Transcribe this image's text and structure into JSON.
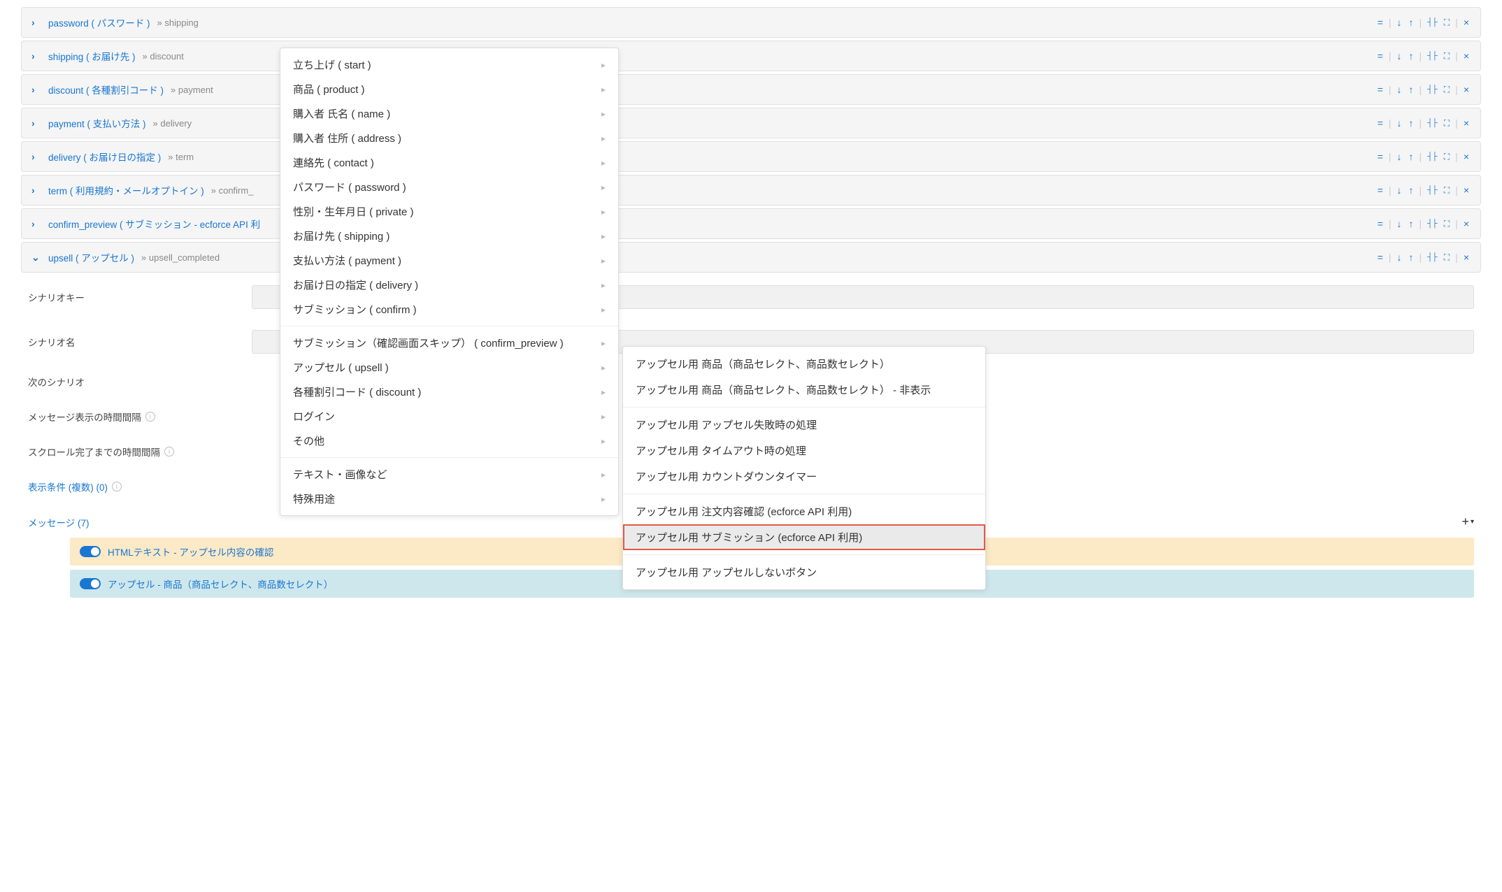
{
  "sections": [
    {
      "name": "password ( パスワード )",
      "next": "» shipping",
      "expanded": false
    },
    {
      "name": "shipping ( お届け先 )",
      "next": "» discount",
      "expanded": false
    },
    {
      "name": "discount ( 各種割引コード )",
      "next": "» payment",
      "expanded": false
    },
    {
      "name": "payment ( 支払い方法 )",
      "next": "» delivery",
      "expanded": false
    },
    {
      "name": "delivery ( お届け日の指定 )",
      "next": "» term",
      "expanded": false
    },
    {
      "name": "term ( 利用規約・メールオプトイン )",
      "next": "» confirm_",
      "expanded": false
    },
    {
      "name": "confirm_preview ( サブミッション - ecforce API 利",
      "next": "",
      "expanded": false
    },
    {
      "name": "upsell ( アップセル )",
      "next": "» upsell_completed",
      "expanded": true
    }
  ],
  "actions": {
    "equals": "=",
    "down": "↓",
    "up": "↑",
    "collapse_h": "┤├",
    "expand": "⛶",
    "close": "×"
  },
  "detail": {
    "labels": {
      "scenario_key": "シナリオキー",
      "scenario_name": "シナリオ名",
      "next_scenario": "次のシナリオ",
      "msg_interval": "メッセージ表示の時間間隔",
      "scroll_interval": "スクロール完了までの時間間隔",
      "display_cond": "表示条件 (複数) (0)",
      "messages": "メッセージ (7)"
    },
    "messages": [
      {
        "text": "HTMLテキスト - アップセル内容の確認",
        "color": "yellow"
      },
      {
        "text": "アップセル - 商品（商品セレクト、商品数セレクト）",
        "color": "blue"
      }
    ]
  },
  "dropdown1_groups": [
    {
      "items": [
        {
          "label": "立ち上げ ( start )"
        },
        {
          "label": "商品 ( product )"
        },
        {
          "label": "購入者 氏名 ( name )"
        },
        {
          "label": "購入者 住所 ( address )"
        },
        {
          "label": "連絡先 ( contact )"
        },
        {
          "label": "パスワード ( password )"
        },
        {
          "label": "性別・生年月日 ( private )"
        },
        {
          "label": "お届け先 ( shipping )"
        },
        {
          "label": "支払い方法 ( payment )"
        },
        {
          "label": "お届け日の指定 ( delivery )"
        },
        {
          "label": "サブミッション ( confirm )"
        }
      ]
    },
    {
      "items": [
        {
          "label": "サブミッション（確認画面スキップ） ( confirm_preview )"
        },
        {
          "label": "アップセル ( upsell )"
        },
        {
          "label": "各種割引コード ( discount )"
        },
        {
          "label": "ログイン"
        },
        {
          "label": "その他"
        }
      ]
    },
    {
      "items": [
        {
          "label": "テキスト・画像など"
        },
        {
          "label": "特殊用途"
        }
      ]
    }
  ],
  "dropdown2_groups": [
    {
      "items": [
        {
          "label": "アップセル用 商品（商品セレクト、商品数セレクト）"
        },
        {
          "label": "アップセル用 商品（商品セレクト、商品数セレクト） - 非表示"
        }
      ]
    },
    {
      "items": [
        {
          "label": "アップセル用 アップセル失敗時の処理"
        },
        {
          "label": "アップセル用 タイムアウト時の処理"
        },
        {
          "label": "アップセル用 カウントダウンタイマー"
        }
      ]
    },
    {
      "items": [
        {
          "label": "アップセル用 注文内容確認 (ecforce API 利用)"
        },
        {
          "label": "アップセル用 サブミッション (ecforce API 利用)",
          "highlighted": true
        }
      ]
    },
    {
      "items": [
        {
          "label": "アップセル用 アップセルしないボタン"
        }
      ]
    }
  ]
}
